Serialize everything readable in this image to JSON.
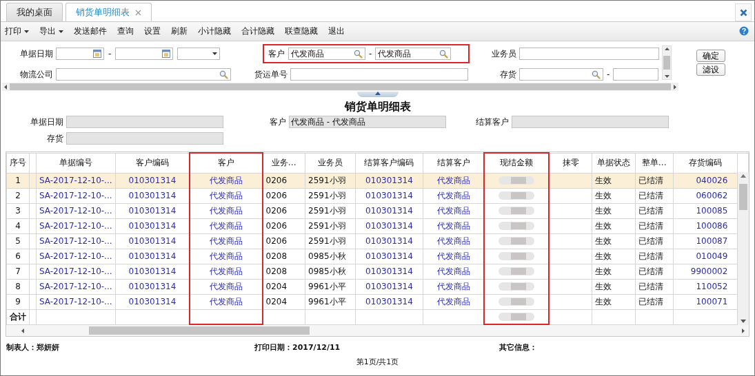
{
  "tabs": [
    {
      "label": "我的桌面",
      "selected": false,
      "closable": false
    },
    {
      "label": "销货单明细表",
      "selected": true,
      "closable": true
    }
  ],
  "toolbar": [
    {
      "label": "打印",
      "kind": "dropdown"
    },
    {
      "label": "导出",
      "kind": "dropdown"
    },
    {
      "label": "发送邮件",
      "kind": "button"
    },
    {
      "label": "查询",
      "kind": "button"
    },
    {
      "label": "设置",
      "kind": "button"
    },
    {
      "label": "刷新",
      "kind": "button"
    },
    {
      "label": "小计隐藏",
      "kind": "button"
    },
    {
      "label": "合计隐藏",
      "kind": "button"
    },
    {
      "label": "联查隐藏",
      "kind": "button"
    },
    {
      "label": "退出",
      "kind": "button"
    }
  ],
  "filters": {
    "date": {
      "label": "单据日期",
      "separator": "-"
    },
    "customer": {
      "label": "客户",
      "from": "代发商品",
      "to": "代发商品",
      "separator": "-",
      "highlighted": true
    },
    "salesperson": {
      "label": "业务员"
    },
    "logistics": {
      "label": "物流公司"
    },
    "waybill": {
      "label": "货运单号"
    },
    "item": {
      "label": "存货",
      "separator": "-"
    }
  },
  "buttons": [
    "确定",
    "滤设"
  ],
  "report": {
    "title": "销货单明细表",
    "date_label": "单据日期",
    "customer_label": "客户",
    "customer_value": "代发商品 - 代发商品",
    "settle_label": "结算客户",
    "item_label": "存货"
  },
  "table": {
    "columns": [
      {
        "label": "序号",
        "highlighted": false
      },
      {
        "label": "单据编号",
        "highlighted": false
      },
      {
        "label": "客户编码",
        "highlighted": false
      },
      {
        "label": "客户",
        "highlighted": true
      },
      {
        "label": "业务…",
        "highlighted": false
      },
      {
        "label": "业务员",
        "highlighted": false
      },
      {
        "label": "结算客户编码",
        "highlighted": false
      },
      {
        "label": "结算客户",
        "highlighted": false
      },
      {
        "label": "现结金额",
        "highlighted": true
      },
      {
        "label": "抹零",
        "highlighted": false
      },
      {
        "label": "单据状态",
        "highlighted": false
      },
      {
        "label": "整单…",
        "highlighted": false
      },
      {
        "label": "存货编码",
        "highlighted": false
      }
    ],
    "rows": [
      {
        "seq": "1",
        "doc_no": "SA-2017-12-10-...",
        "customer_code": "010301314",
        "customer": "代发商品",
        "column_5": "0206",
        "salesperson": "2591小羽",
        "settle_code": "010301314",
        "settle_customer": "代发商品",
        "amount_blurred": true,
        "status": "生效",
        "settled": "已结清",
        "item_code": "040026",
        "selected": true
      },
      {
        "seq": "2",
        "doc_no": "SA-2017-12-10-...",
        "customer_code": "010301314",
        "customer": "代发商品",
        "column_5": "0206",
        "salesperson": "2591小羽",
        "settle_code": "010301314",
        "settle_customer": "代发商品",
        "amount_blurred": true,
        "status": "生效",
        "settled": "已结清",
        "item_code": "060062",
        "selected": false
      },
      {
        "seq": "3",
        "doc_no": "SA-2017-12-10-...",
        "customer_code": "010301314",
        "customer": "代发商品",
        "column_5": "0206",
        "salesperson": "2591小羽",
        "settle_code": "010301314",
        "settle_customer": "代发商品",
        "amount_blurred": true,
        "status": "生效",
        "settled": "已结清",
        "item_code": "100085",
        "selected": false
      },
      {
        "seq": "4",
        "doc_no": "SA-2017-12-10-...",
        "customer_code": "010301314",
        "customer": "代发商品",
        "column_5": "0206",
        "salesperson": "2591小羽",
        "settle_code": "010301314",
        "settle_customer": "代发商品",
        "amount_blurred": true,
        "status": "生效",
        "settled": "已结清",
        "item_code": "100086",
        "selected": false
      },
      {
        "seq": "5",
        "doc_no": "SA-2017-12-10-...",
        "customer_code": "010301314",
        "customer": "代发商品",
        "column_5": "0206",
        "salesperson": "2591小羽",
        "settle_code": "010301314",
        "settle_customer": "代发商品",
        "amount_blurred": true,
        "status": "生效",
        "settled": "已结清",
        "item_code": "100087",
        "selected": false
      },
      {
        "seq": "6",
        "doc_no": "SA-2017-12-10-...",
        "customer_code": "010301314",
        "customer": "代发商品",
        "column_5": "0208",
        "salesperson": "0985小秋",
        "settle_code": "010301314",
        "settle_customer": "代发商品",
        "amount_blurred": true,
        "status": "生效",
        "settled": "已结清",
        "item_code": "010049",
        "selected": false
      },
      {
        "seq": "7",
        "doc_no": "SA-2017-12-10-...",
        "customer_code": "010301314",
        "customer": "代发商品",
        "column_5": "0208",
        "salesperson": "0985小秋",
        "settle_code": "010301314",
        "settle_customer": "代发商品",
        "amount_blurred": true,
        "status": "生效",
        "settled": "已结清",
        "item_code": "9900002",
        "selected": false
      },
      {
        "seq": "8",
        "doc_no": "SA-2017-12-10-...",
        "customer_code": "010301314",
        "customer": "代发商品",
        "column_5": "0204",
        "salesperson": "9961小平",
        "settle_code": "010301314",
        "settle_customer": "代发商品",
        "amount_blurred": true,
        "status": "生效",
        "settled": "已结清",
        "item_code": "110052",
        "selected": false
      },
      {
        "seq": "9",
        "doc_no": "SA-2017-12-10-...",
        "customer_code": "010301314",
        "customer": "代发商品",
        "column_5": "0204",
        "salesperson": "9961小平",
        "settle_code": "010301314",
        "settle_customer": "代发商品",
        "amount_blurred": true,
        "status": "生效",
        "settled": "已结清",
        "item_code": "100071",
        "selected": false
      }
    ],
    "total_label": "合计",
    "total_amount_blurred": true
  },
  "footer": {
    "maker": "制表人：郑妍妍",
    "print_date": "打印日期：2017/12/11",
    "other": "其它信息：",
    "page": "第1页/共1页"
  }
}
